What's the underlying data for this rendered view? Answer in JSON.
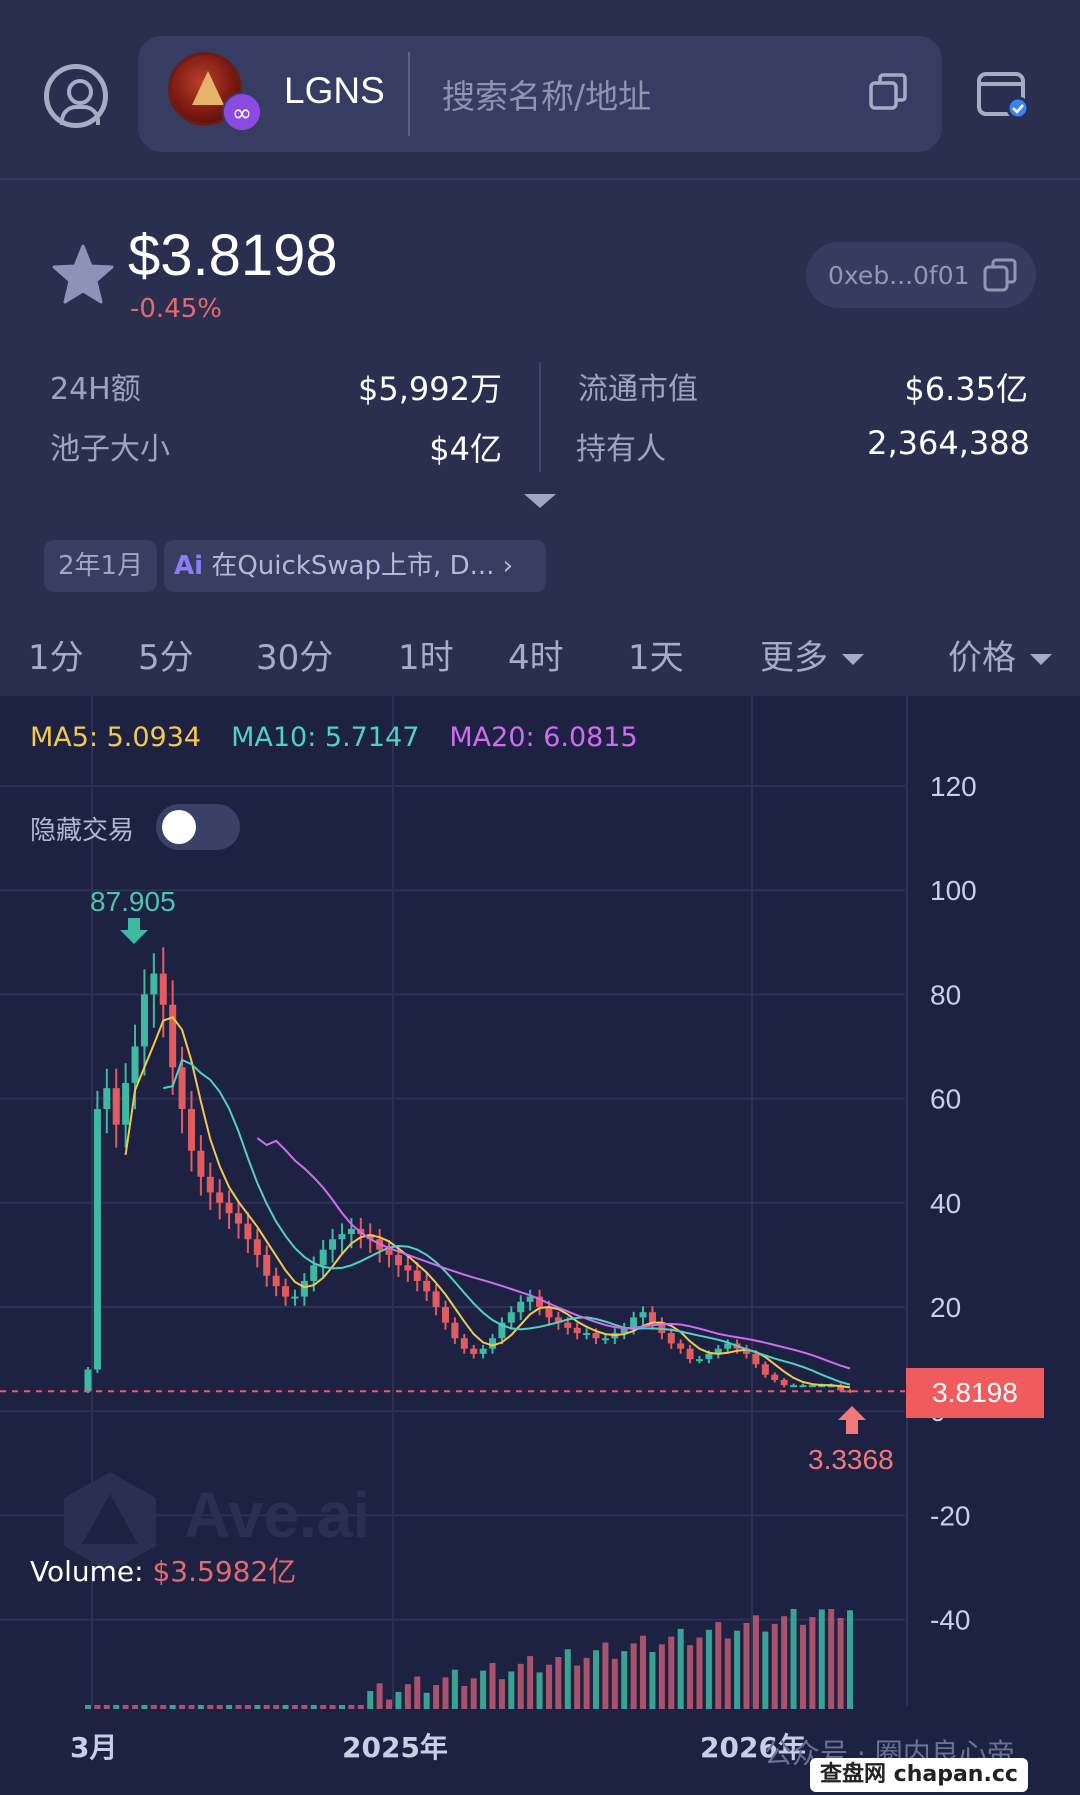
{
  "header": {
    "token_name": "LGNS",
    "search_placeholder": "搜索名称/地址"
  },
  "price": {
    "value": "$3.8198",
    "change_pct": "-0.45%",
    "address": "0xeb...0f01"
  },
  "stats": {
    "left": [
      {
        "label": "24H额",
        "value": "$5,992万"
      },
      {
        "label": "池子大小",
        "value": "$4亿"
      }
    ],
    "right": [
      {
        "label": "流通市值",
        "value": "$6.35亿"
      },
      {
        "label": "持有人",
        "value": "2,364,388"
      }
    ]
  },
  "tags": {
    "date": "2年1月",
    "ai_badge": "Ai",
    "ai_text": "在QuickSwap上市, D..."
  },
  "tabs": [
    "1分",
    "5分",
    "30分",
    "1时",
    "4时",
    "1天"
  ],
  "tab_more": "更多",
  "tab_price": "价格",
  "chart": {
    "ma5": "MA5: 5.0934",
    "ma10": "MA10: 5.7147",
    "ma20": "MA20: 6.0815",
    "hide_trades": "隐藏交易",
    "watermark": "Ave.ai",
    "volume_label": "Volume: ",
    "volume_value": "$3.5982亿",
    "peak_label": "87.905",
    "low_label": "3.3368",
    "current_marker": "3.8198",
    "footer_watermark": "公众号 · 圈内良心帝",
    "site_badge": "查盘网 chapan.cc"
  },
  "chart_data": {
    "type": "candlestick",
    "y_ticks": [
      "120",
      "100",
      "80",
      "60",
      "40",
      "20",
      "0",
      "-20",
      "-40"
    ],
    "x_ticks": [
      "3月",
      "2025年",
      "2026年"
    ],
    "ylim": [
      -40,
      120
    ],
    "peak": 87.905,
    "low": 3.3368,
    "current": 3.8198,
    "close_series": [
      8,
      58,
      62,
      55,
      63,
      70,
      80,
      84,
      78,
      66,
      58,
      50,
      45,
      42,
      40,
      38,
      36,
      33,
      30,
      26,
      24,
      22,
      22,
      25,
      28,
      31,
      33,
      34,
      35,
      34,
      33,
      31,
      30,
      28,
      27,
      25,
      23,
      20,
      17,
      14,
      12,
      11,
      12,
      14,
      17,
      19,
      21,
      22,
      20,
      18,
      17,
      16,
      15,
      15,
      14,
      14,
      15,
      16,
      18,
      19,
      17,
      15,
      13,
      12,
      10,
      10,
      11,
      12,
      13,
      12,
      11,
      9,
      7,
      6,
      5,
      5,
      5,
      5,
      5,
      5,
      4,
      3.82
    ]
  }
}
